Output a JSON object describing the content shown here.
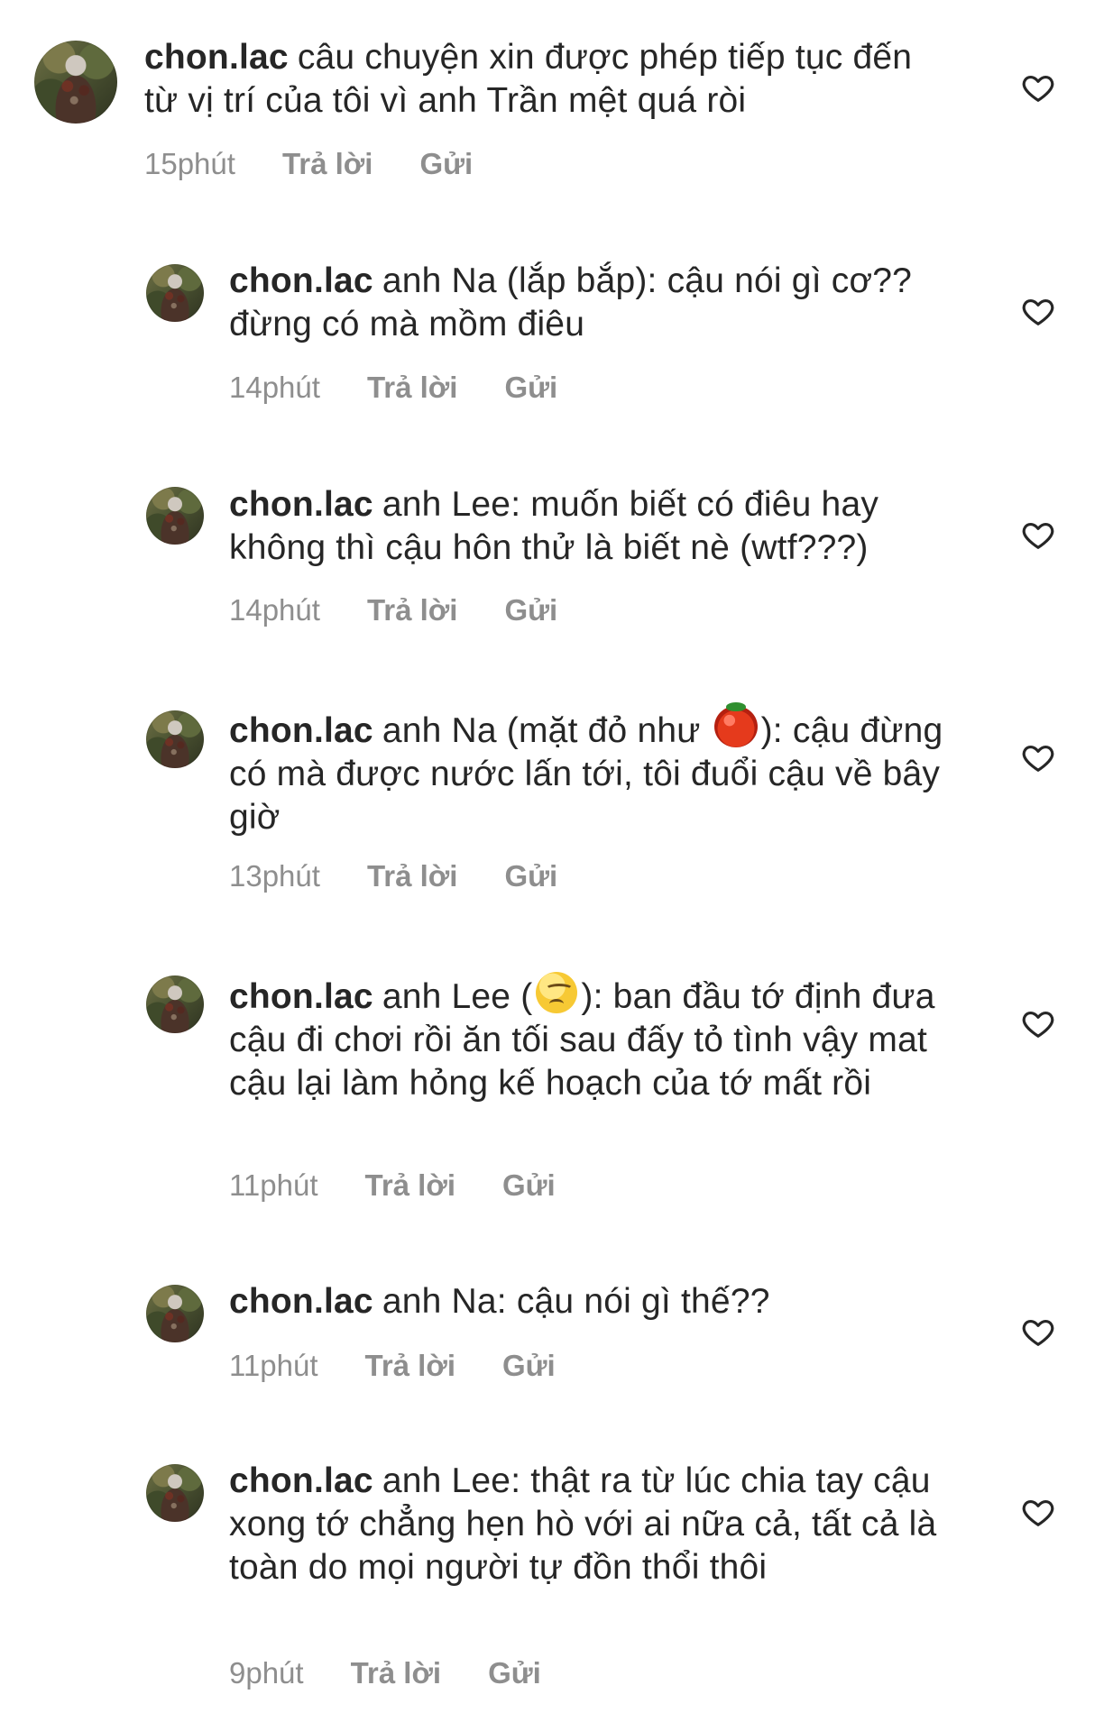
{
  "comments": [
    {
      "username": "chon.lac",
      "text": "câu chuyện xin được phép tiếp tục đến từ vị trí của tôi vì anh Trần mệt quá ròi",
      "time": "15phút",
      "reply_label": "Trả lời",
      "send_label": "Gửi"
    }
  ],
  "replies": [
    {
      "username": "chon.lac",
      "text": "anh Na (lắp bắp): cậu nói gì cơ?? đừng có mà mồm điêu",
      "time": "14phút",
      "reply_label": "Trả lời",
      "send_label": "Gửi"
    },
    {
      "username": "chon.lac",
      "text": "anh Lee: muốn biết có điêu hay không thì cậu hôn thử là biết nè (wtf???)",
      "time": "14phút",
      "reply_label": "Trả lời",
      "send_label": "Gửi"
    },
    {
      "username": "chon.lac",
      "text_before": "anh Na (mặt đỏ như ",
      "emoji": "tomato-emoji",
      "text_after": "): cậu đừng có mà được nước lấn tới, tôi đuổi cậu về bây giờ",
      "time": "13phút",
      "reply_label": "Trả lời",
      "send_label": "Gửi"
    },
    {
      "username": "chon.lac",
      "text_before": "anh Lee (",
      "emoji": "disappointed-face-emoji",
      "text_after": "): ban đầu tớ định đưa cậu đi chơi rồi ăn tối sau đấy tỏ tình vậy mat cậu lại làm hỏng kế hoạch của tớ mất rồi",
      "time": "11phút",
      "reply_label": "Trả lời",
      "send_label": "Gửi"
    },
    {
      "username": "chon.lac",
      "text": "anh Na: cậu nói gì thế??",
      "time": "11phút",
      "reply_label": "Trả lời",
      "send_label": "Gửi"
    },
    {
      "username": "chon.lac",
      "text": "anh Lee: thật ra từ lúc chia tay cậu xong tớ chẳng hẹn hò với ai nữa cả, tất cả là toàn do mọi người tự đồn thổi thôi",
      "time": "9phút",
      "reply_label": "Trả lời",
      "send_label": "Gửi"
    }
  ],
  "icons": {
    "avatar": "profile-photo",
    "heart": "heart-outline-icon"
  },
  "colors": {
    "text": "#262626",
    "meta": "#8e8e8e",
    "background": "#ffffff"
  }
}
